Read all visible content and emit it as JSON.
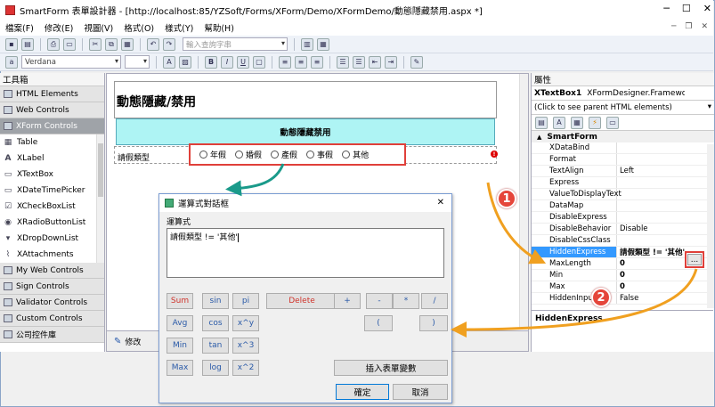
{
  "window": {
    "title": "SmartForm 表單設計器 - [http://localhost:85/YZSoft/Forms/XForm/Demo/XFormDemo/動態隱藏禁用.aspx *]",
    "min": "─",
    "max": "☐",
    "close": "✕"
  },
  "menu": {
    "items": [
      "檔案(F)",
      "修改(E)",
      "視圖(V)",
      "格式(O)",
      "樣式(Y)",
      "幫助(H)"
    ],
    "mdi_min": "─",
    "mdi_restore": "❐",
    "mdi_close": "✕"
  },
  "toolbar": {
    "search_placeholder": "輸入查詢字串",
    "font_name": "Verdana",
    "font_size": "",
    "bold": "B",
    "italic": "I",
    "underline": "U"
  },
  "toolbox": {
    "title": "工具箱",
    "groups_top": [
      "HTML Elements",
      "Web Controls",
      "XForm Controls"
    ],
    "items": [
      "Table",
      "XLabel",
      "XTextBox",
      "XDateTimePicker",
      "XCheckBoxList",
      "XRadioButtonList",
      "XDropDownList",
      "XAttachments"
    ],
    "groups_bottom": [
      "My Web Controls",
      "Sign Controls",
      "Validator Controls",
      "Custom Controls",
      "公司控件庫"
    ]
  },
  "design": {
    "form_title": "動態隱藏/禁用",
    "header_cell": "動態隱藏禁用",
    "field_label": "請假類型",
    "radio_options": [
      "年假",
      "婚假",
      "產假",
      "事假",
      "其他"
    ],
    "bottom_tab": "修改"
  },
  "props": {
    "title": "屬性",
    "object_name": "XTextBox1",
    "object_type": "XFormDesigner.Framework.Web.UI",
    "parent_link": "(Click to see parent HTML elements)",
    "category": "SmartForm",
    "rows": [
      {
        "name": "XDataBind",
        "value": ""
      },
      {
        "name": "Format",
        "value": ""
      },
      {
        "name": "TextAlign",
        "value": "Left"
      },
      {
        "name": "Express",
        "value": ""
      },
      {
        "name": "ValueToDisplayText",
        "value": ""
      },
      {
        "name": "DataMap",
        "value": ""
      },
      {
        "name": "DisableExpress",
        "value": ""
      },
      {
        "name": "DisableBehavior",
        "value": "Disable"
      },
      {
        "name": "DisableCssClass",
        "value": ""
      },
      {
        "name": "HiddenExpress",
        "value": "請假類型 != '其他'"
      },
      {
        "name": "MaxLength",
        "value": "0"
      },
      {
        "name": "Min",
        "value": "0"
      },
      {
        "name": "Max",
        "value": "0"
      },
      {
        "name": "HiddenInput",
        "value": "False"
      }
    ],
    "ellipsis": "...",
    "description_title": "HiddenExpress"
  },
  "dialog": {
    "title": "運算式對話框",
    "close": "✕",
    "label": "運算式",
    "expression": "請假類型 != '其他'",
    "buttons_row1": [
      "Sum",
      "sin",
      "pi",
      "Delete",
      "+",
      "-",
      "*",
      "/"
    ],
    "buttons_row2": [
      "Avg",
      "cos",
      "x^y",
      "(",
      ")"
    ],
    "buttons_row3": [
      "Min",
      "tan",
      "x^3"
    ],
    "buttons_row4": [
      "Max",
      "log",
      "x^2"
    ],
    "insert_var": "插入表單變數",
    "ok": "確定",
    "cancel": "取消"
  },
  "callouts": [
    "1",
    "2"
  ]
}
